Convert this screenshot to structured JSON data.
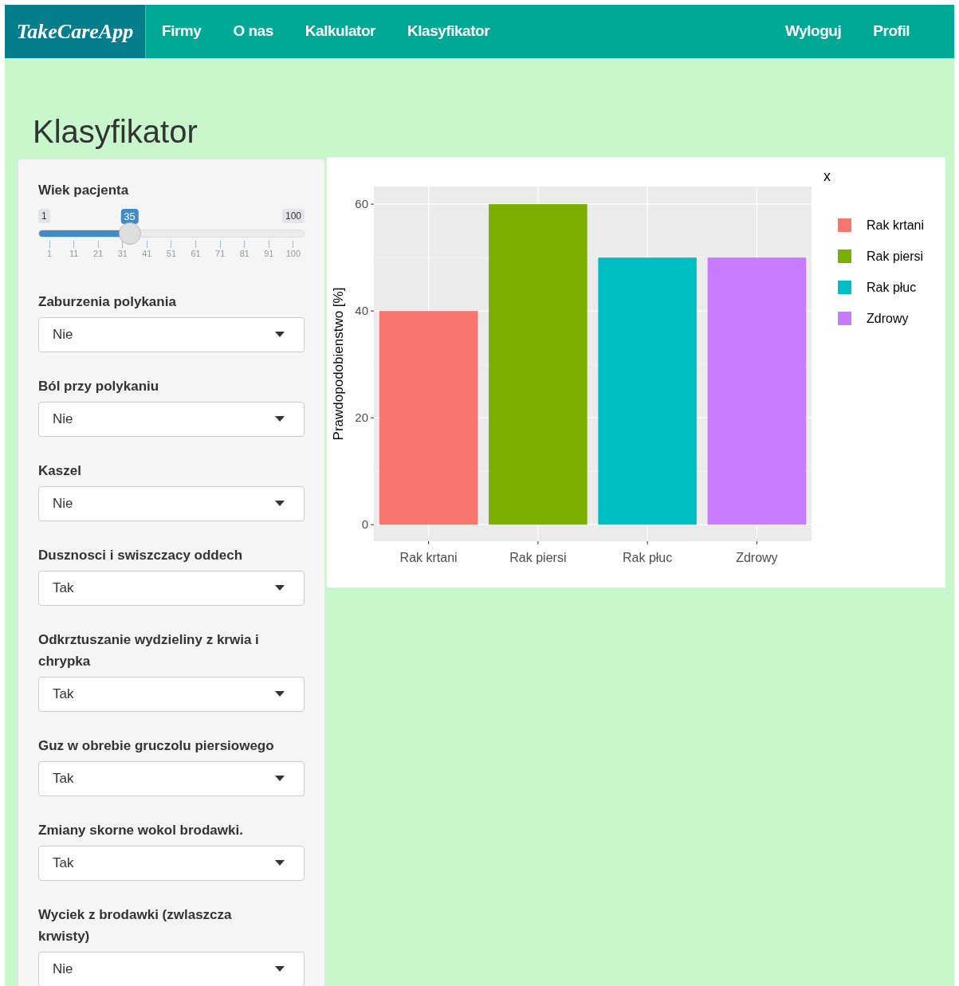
{
  "navbar": {
    "brand": "TakeCareApp",
    "items_left": [
      "Firmy",
      "O nas",
      "Kalkulator",
      "Klasyfikator"
    ],
    "items_right": [
      "Wyloguj",
      "Profil"
    ]
  },
  "page_title": "Klasyfikator",
  "slider": {
    "label": "Wiek pacjenta",
    "min_label": "1",
    "max_label": "100",
    "value_label": "35",
    "level": 0.343,
    "tick_labels": [
      "1",
      "11",
      "21",
      "31",
      "41",
      "51",
      "61",
      "71",
      "81",
      "91",
      "100"
    ]
  },
  "fields": [
    {
      "label": "Zaburzenia polykania",
      "value": "Nie"
    },
    {
      "label": "Ból przy polykaniu",
      "value": "Nie"
    },
    {
      "label": "Kaszel",
      "value": "Nie"
    },
    {
      "label": "Dusznosci i swiszczacy oddech",
      "value": "Tak"
    },
    {
      "label": "Odkrztuszanie wydzieliny z krwia i chrypka",
      "value": "Tak"
    },
    {
      "label": "Guz w obrebie gruczolu piersiowego",
      "value": "Tak"
    },
    {
      "label": "Zmiany skorne wokol brodawki.",
      "value": "Tak"
    },
    {
      "label": "Wyciek z brodawki (zwlaszcza krwisty)",
      "value": "Nie"
    }
  ],
  "chart": {
    "chart_data": {
      "type": "bar",
      "ylabel": "Prawdopodobienstwo [%]",
      "legend_title": "x",
      "categories": [
        "Rak krtani",
        "Rak piersi",
        "Rak płuc",
        "Zdrowy"
      ],
      "values": [
        40,
        60,
        50,
        50
      ],
      "grid": true,
      "colors": [
        "#f8766d",
        "#7cae00",
        "#00bfc4",
        "#c77cff"
      ],
      "ylim": [
        -3.1,
        63.3
      ],
      "yticks": [
        0,
        20,
        40,
        60
      ]
    }
  }
}
